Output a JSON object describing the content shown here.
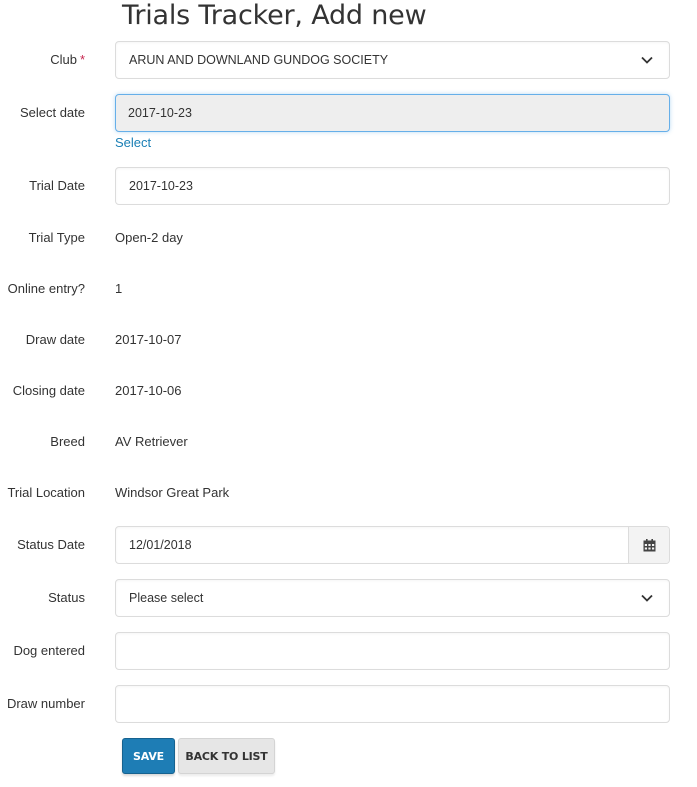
{
  "page": {
    "title": "Trials Tracker, Add new"
  },
  "form": {
    "club": {
      "label": "Club",
      "required_mark": "*",
      "value": "ARUN AND DOWNLAND GUNDOG SOCIETY"
    },
    "select_date": {
      "label": "Select date",
      "value": "2017-10-23",
      "link": "Select"
    },
    "trial_date": {
      "label": "Trial Date",
      "value": "2017-10-23"
    },
    "trial_type": {
      "label": "Trial Type",
      "value": "Open-2 day"
    },
    "online_entry": {
      "label": "Online entry?",
      "value": "1"
    },
    "draw_date": {
      "label": "Draw date",
      "value": "2017-10-07"
    },
    "closing_date": {
      "label": "Closing date",
      "value": "2017-10-06"
    },
    "breed": {
      "label": "Breed",
      "value": "AV Retriever"
    },
    "trial_location": {
      "label": "Trial Location",
      "value": "Windsor Great Park"
    },
    "status_date": {
      "label": "Status Date",
      "value": "12/01/2018",
      "icon": "calendar-icon"
    },
    "status": {
      "label": "Status",
      "value": "Please select"
    },
    "dog_entered": {
      "label": "Dog entered",
      "value": ""
    },
    "draw_number": {
      "label": "Draw number",
      "value": ""
    }
  },
  "buttons": {
    "save": "SAVE",
    "back": "BACK TO LIST"
  },
  "colors": {
    "primary": "#1e7db5",
    "link": "#1a7fb5",
    "required": "#c7254e"
  }
}
